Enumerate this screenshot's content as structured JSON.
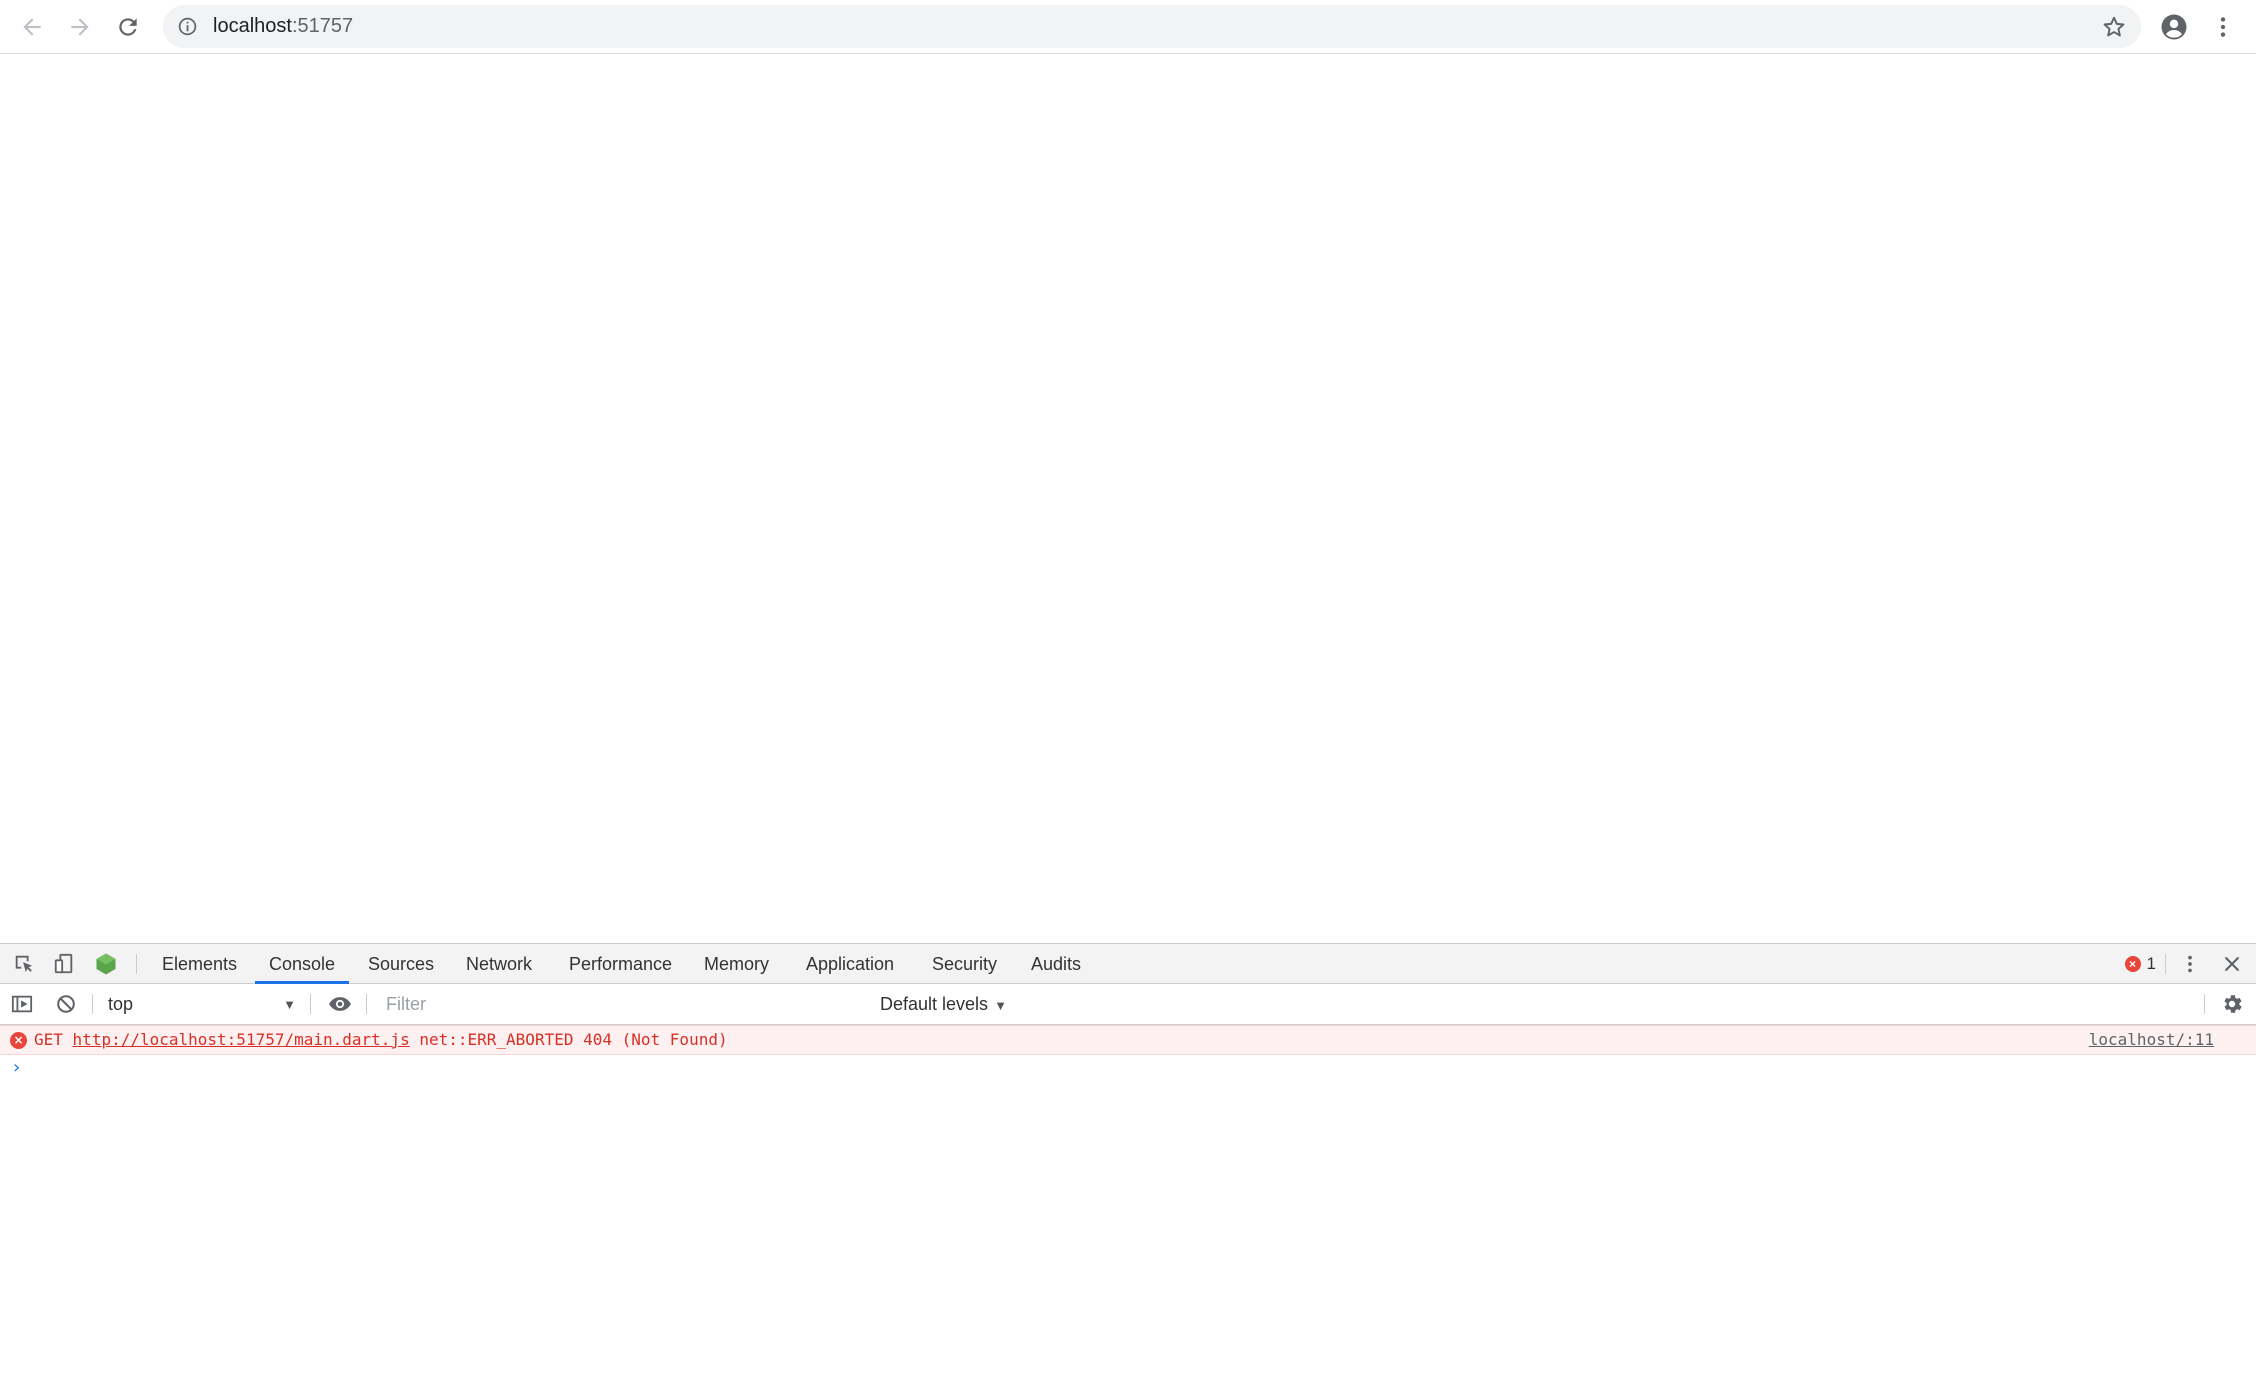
{
  "browser": {
    "url_host": "localhost",
    "url_port": ":51757"
  },
  "devtools": {
    "tabs": [
      {
        "label": "Elements"
      },
      {
        "label": "Console"
      },
      {
        "label": "Sources"
      },
      {
        "label": "Network"
      },
      {
        "label": "Performance"
      },
      {
        "label": "Memory"
      },
      {
        "label": "Application"
      },
      {
        "label": "Security"
      },
      {
        "label": "Audits"
      }
    ],
    "active_tab": "Console",
    "error_count": "1",
    "console": {
      "context": "top",
      "filter_placeholder": "Filter",
      "levels_label": "Default levels",
      "messages": [
        {
          "level": "error",
          "method": "GET",
          "url": "http://localhost:51757/main.dart.js",
          "detail": "net::ERR_ABORTED 404 (Not Found)",
          "source": "localhost/:11"
        }
      ]
    }
  },
  "colors": {
    "accent": "#1a73e8",
    "error": "#d93025",
    "error_bg": "#fdf0f0"
  }
}
